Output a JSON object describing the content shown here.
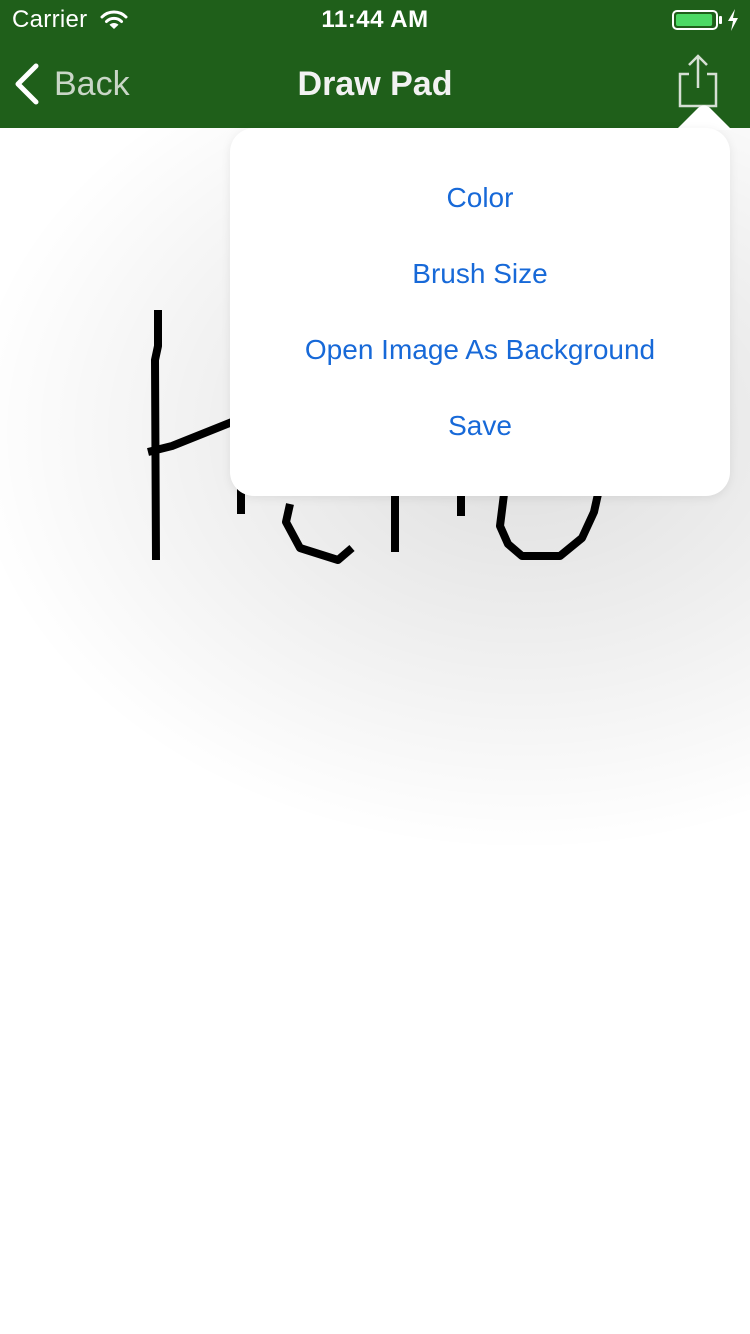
{
  "status_bar": {
    "carrier": "Carrier",
    "time": "11:44 AM",
    "battery_level": 0.95,
    "battery_color": "#4cd964"
  },
  "nav_bar": {
    "back_label": "Back",
    "title": "Draw Pad",
    "background_color": "#1f5f1a",
    "share_icon": "share-icon"
  },
  "canvas": {
    "drawing_text": "Hello",
    "stroke_color": "#000000"
  },
  "popover_menu": {
    "items": [
      {
        "label": "Color"
      },
      {
        "label": "Brush Size"
      },
      {
        "label": "Open Image As Background"
      },
      {
        "label": "Save"
      }
    ],
    "text_color": "#1769d8"
  }
}
